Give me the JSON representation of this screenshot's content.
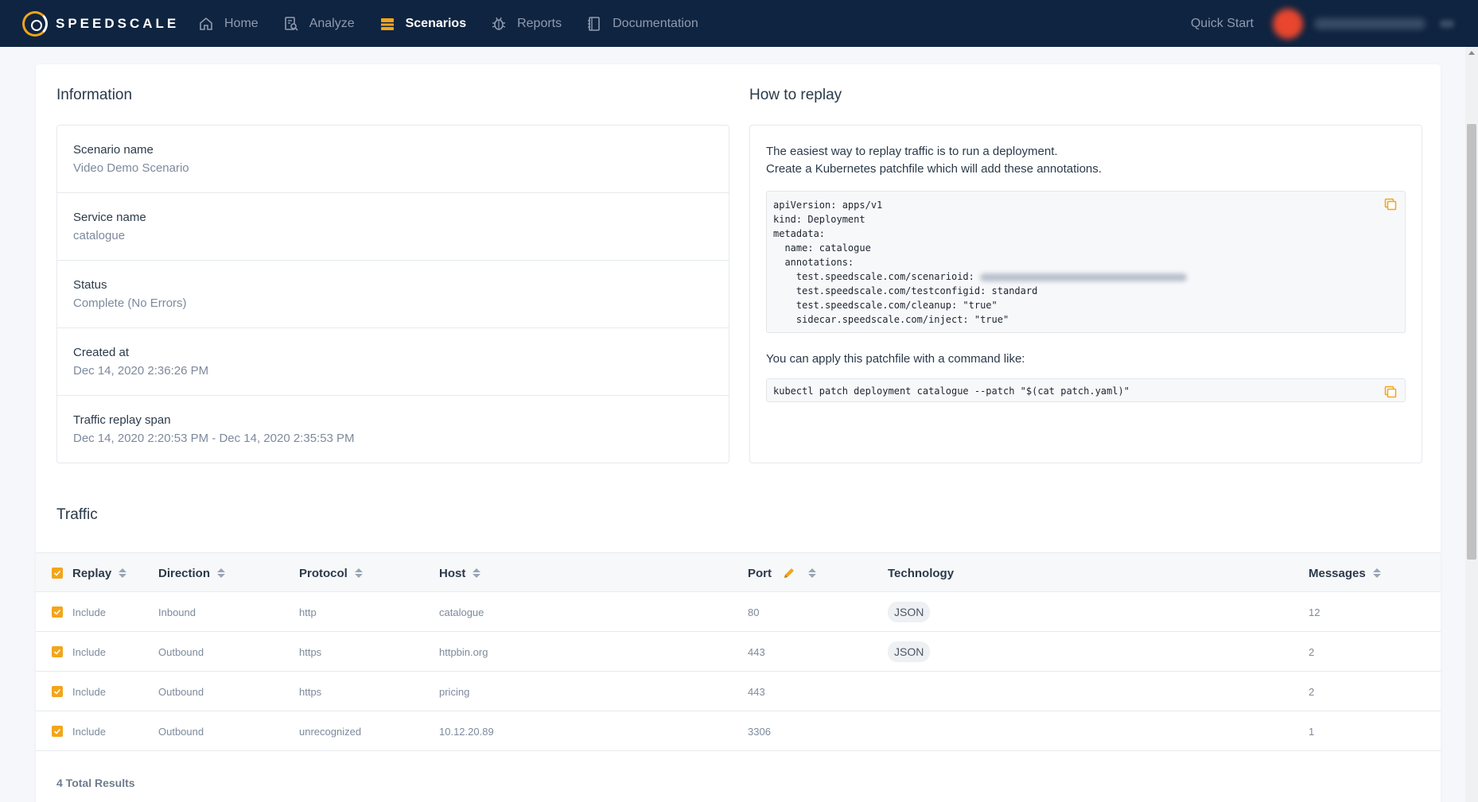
{
  "app": {
    "brand": "SPEEDSCALE",
    "accent_color": "#f3a51b",
    "nav_bg": "#0f2440"
  },
  "nav": {
    "items": [
      {
        "label": "Home",
        "icon": "home-icon",
        "active": false
      },
      {
        "label": "Analyze",
        "icon": "analyze-icon",
        "active": false
      },
      {
        "label": "Scenarios",
        "icon": "scenarios-icon",
        "active": true
      },
      {
        "label": "Reports",
        "icon": "bug-icon",
        "active": false
      },
      {
        "label": "Documentation",
        "icon": "book-icon",
        "active": false
      }
    ],
    "quick_start": "Quick Start"
  },
  "information": {
    "title": "Information",
    "rows": [
      {
        "label": "Scenario name",
        "value": "Video Demo Scenario"
      },
      {
        "label": "Service name",
        "value": "catalogue"
      },
      {
        "label": "Status",
        "value": "Complete (No Errors)"
      },
      {
        "label": "Created at",
        "value": "Dec 14, 2020 2:36:26 PM"
      },
      {
        "label": "Traffic replay span",
        "value": "Dec 14, 2020 2:20:53 PM - Dec 14, 2020 2:35:53 PM"
      }
    ]
  },
  "replay": {
    "title": "How to replay",
    "intro_line1": "The easiest way to replay traffic is to run a deployment.",
    "intro_line2": "Create a Kubernetes patchfile which will add these annotations.",
    "code_lines": [
      "apiVersion: apps/v1",
      "kind: Deployment",
      "metadata:",
      "  name: catalogue",
      "  annotations:",
      "    test.speedscale.com/scenarioid: ",
      "    test.speedscale.com/testconfigid: standard",
      "    test.speedscale.com/cleanup: \"true\"",
      "    sidecar.speedscale.com/inject: \"true\""
    ],
    "apply_text": "You can apply this patchfile with a command like:",
    "command": "kubectl patch deployment catalogue --patch \"$(cat patch.yaml)\""
  },
  "traffic": {
    "title": "Traffic",
    "columns": [
      "Replay",
      "Direction",
      "Protocol",
      "Host",
      "Port",
      "Technology",
      "Messages"
    ],
    "rows": [
      {
        "replay": "Include",
        "direction": "Inbound",
        "protocol": "http",
        "host": "catalogue",
        "port": "80",
        "technology": "JSON",
        "messages": "12"
      },
      {
        "replay": "Include",
        "direction": "Outbound",
        "protocol": "https",
        "host": "httpbin.org",
        "port": "443",
        "technology": "JSON",
        "messages": "2"
      },
      {
        "replay": "Include",
        "direction": "Outbound",
        "protocol": "https",
        "host": "pricing",
        "port": "443",
        "technology": "",
        "messages": "2"
      },
      {
        "replay": "Include",
        "direction": "Outbound",
        "protocol": "unrecognized",
        "host": "10.12.20.89",
        "port": "3306",
        "technology": "",
        "messages": "1"
      }
    ],
    "total": "4 Total Results"
  }
}
